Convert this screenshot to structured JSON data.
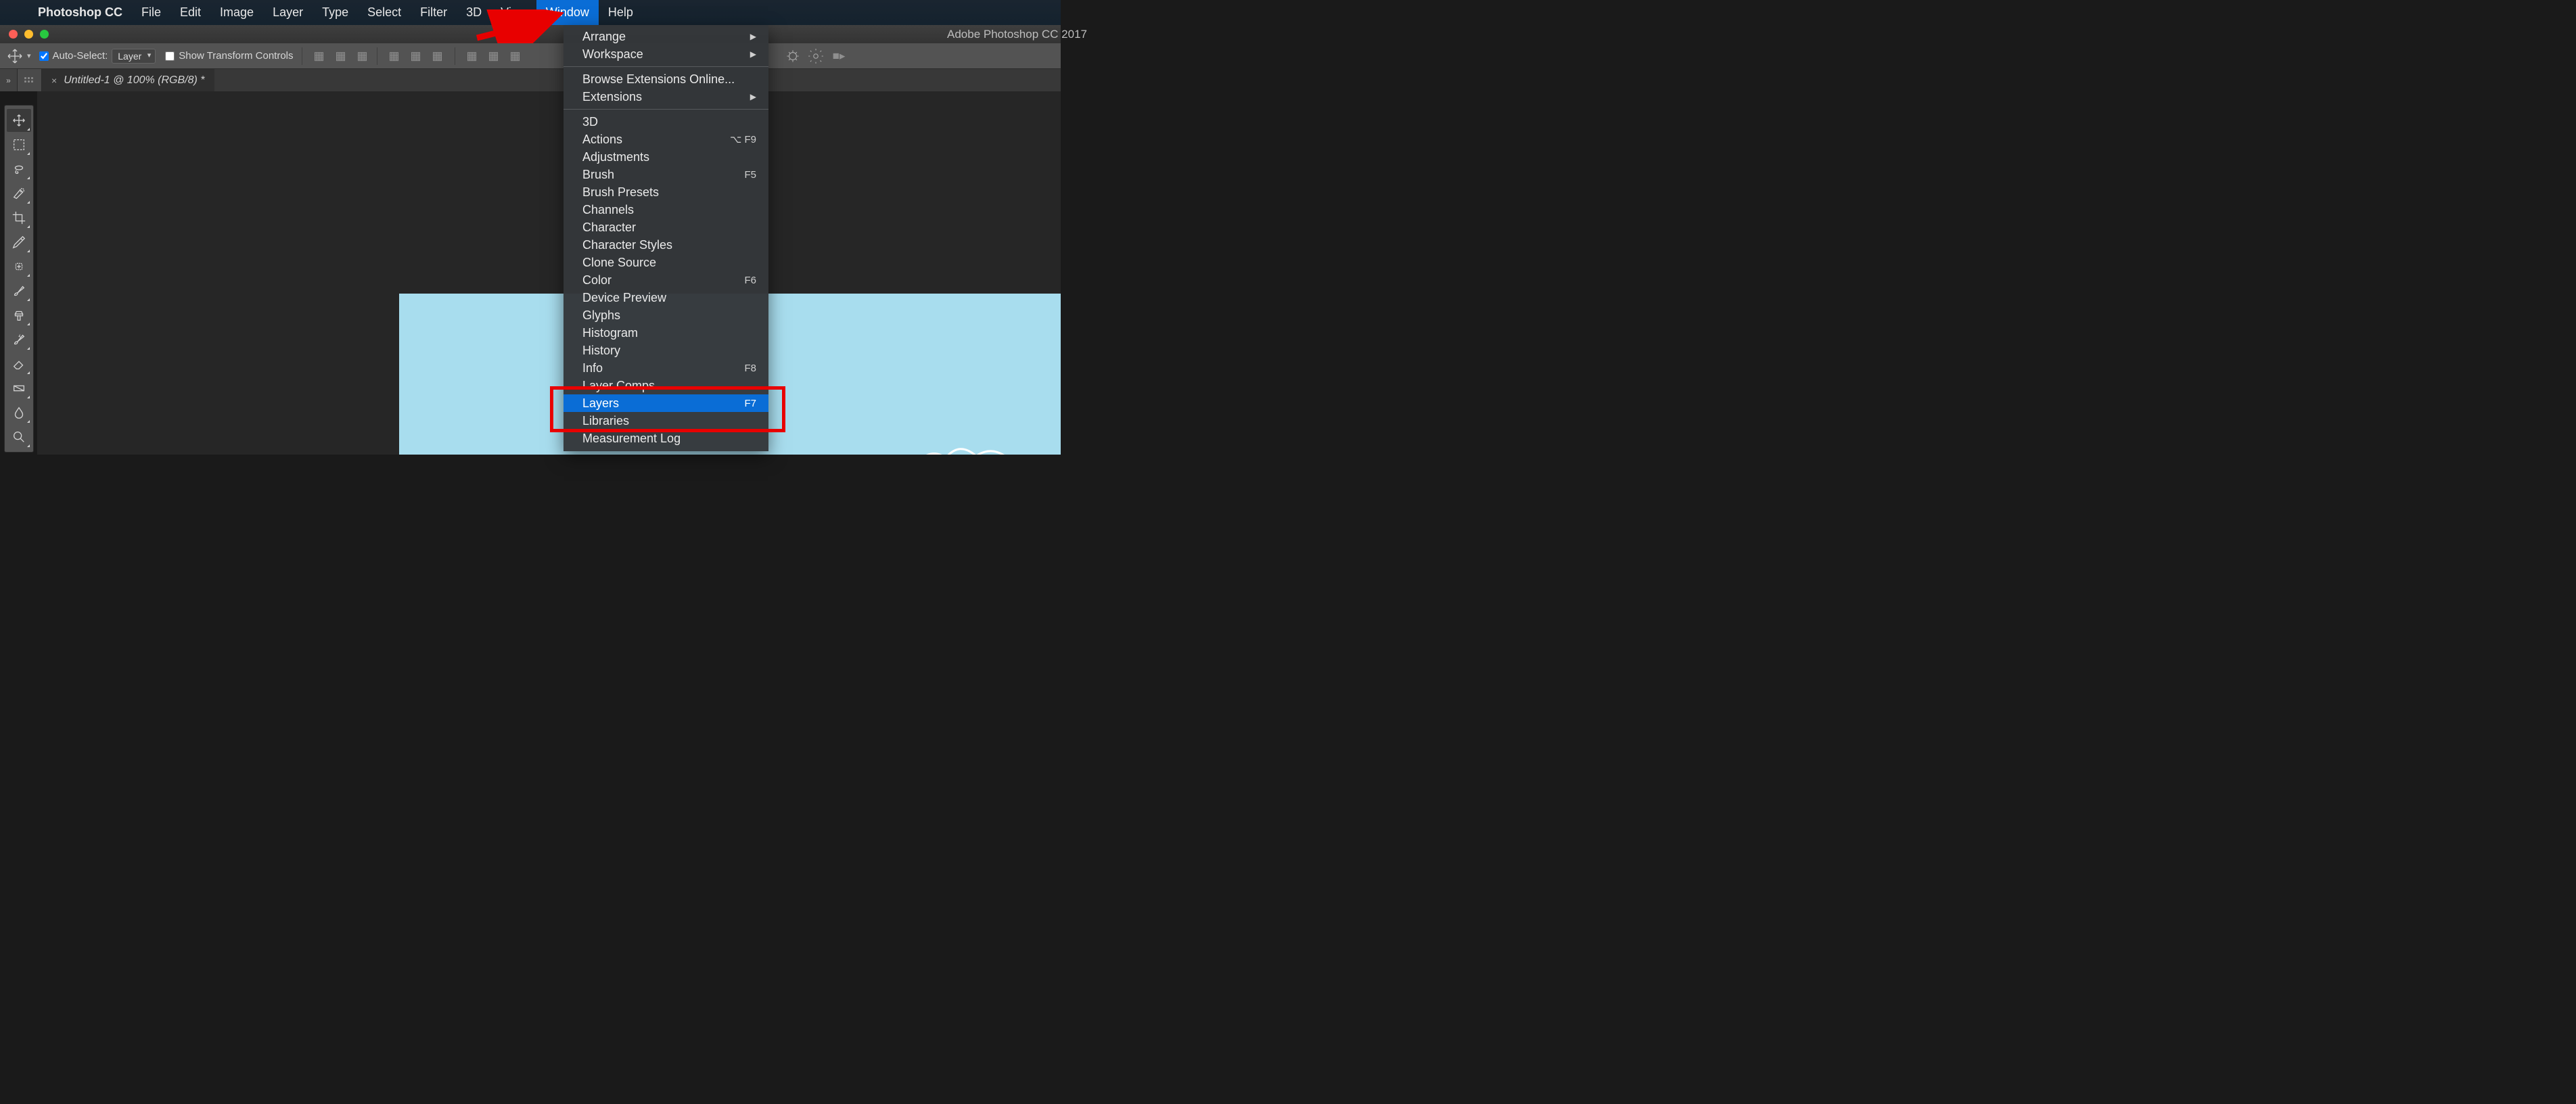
{
  "menubar": {
    "appname": "Photoshop CC",
    "items": [
      "File",
      "Edit",
      "Image",
      "Layer",
      "Type",
      "Select",
      "Filter",
      "3D",
      "View",
      "Window",
      "Help"
    ],
    "selected": "Window"
  },
  "window_title": "Adobe Photoshop CC 2017",
  "options": {
    "auto_select_label": "Auto-Select:",
    "auto_select_checked": true,
    "auto_select_target": "Layer",
    "show_transform_label": "Show Transform Controls",
    "show_transform_checked": false
  },
  "document_tab": {
    "title": "Untitled-1 @ 100% (RGB/8) *"
  },
  "dropdown": {
    "sections": [
      [
        {
          "label": "Arrange",
          "submenu": true
        },
        {
          "label": "Workspace",
          "submenu": true
        }
      ],
      [
        {
          "label": "Browse Extensions Online..."
        },
        {
          "label": "Extensions",
          "submenu": true
        }
      ],
      [
        {
          "label": "3D"
        },
        {
          "label": "Actions",
          "shortcut": "⌥ F9"
        },
        {
          "label": "Adjustments"
        },
        {
          "label": "Brush",
          "shortcut": "F5"
        },
        {
          "label": "Brush Presets"
        },
        {
          "label": "Channels"
        },
        {
          "label": "Character"
        },
        {
          "label": "Character Styles"
        },
        {
          "label": "Clone Source"
        },
        {
          "label": "Color",
          "shortcut": "F6"
        },
        {
          "label": "Device Preview"
        },
        {
          "label": "Glyphs"
        },
        {
          "label": "Histogram"
        },
        {
          "label": "History"
        },
        {
          "label": "Info",
          "shortcut": "F8"
        },
        {
          "label": "Layer Comps"
        },
        {
          "label": "Layers",
          "shortcut": "F7",
          "highlight": true
        },
        {
          "label": "Libraries"
        },
        {
          "label": "Measurement Log"
        }
      ]
    ]
  },
  "tools": [
    "move-tool",
    "rect-marquee-tool",
    "lasso-tool",
    "quick-select-tool",
    "crop-tool",
    "eyedropper-tool",
    "healing-brush-tool",
    "brush-tool",
    "clone-stamp-tool",
    "history-brush-tool",
    "eraser-tool",
    "gradient-tool",
    "blur-tool",
    "dodge-tool"
  ]
}
